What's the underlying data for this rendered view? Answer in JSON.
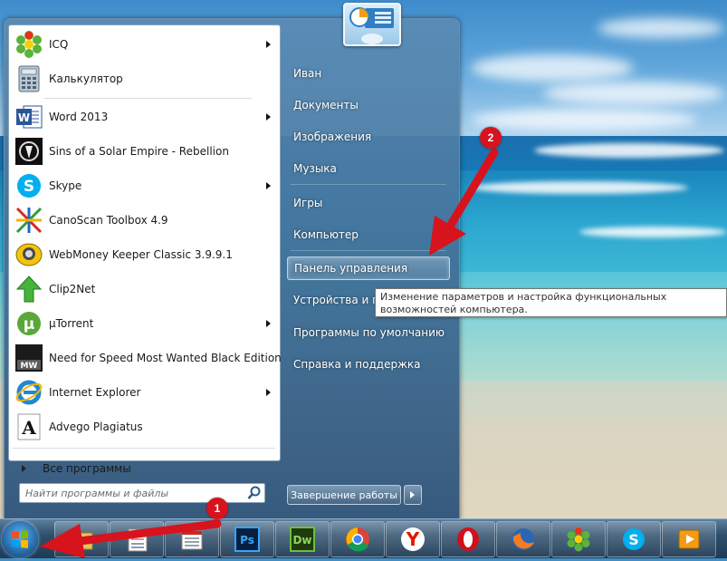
{
  "start_menu": {
    "programs": [
      {
        "label": "ICQ",
        "icon": "icq-flower-icon",
        "submenu": true
      },
      {
        "label": "Калькулятор",
        "icon": "calculator-icon",
        "submenu": false
      },
      {
        "label": "Word 2013",
        "icon": "word-icon",
        "submenu": true
      },
      {
        "label": "Sins of a Solar Empire - Rebellion",
        "icon": "sins-game-icon",
        "submenu": false
      },
      {
        "label": "Skype",
        "icon": "skype-icon",
        "submenu": true
      },
      {
        "label": "CanoScan Toolbox 4.9",
        "icon": "canoscan-icon",
        "submenu": false
      },
      {
        "label": "WebMoney Keeper Classic 3.9.9.1",
        "icon": "webmoney-icon",
        "submenu": false
      },
      {
        "label": "Clip2Net",
        "icon": "clip2net-arrow-icon",
        "submenu": false
      },
      {
        "label": "µTorrent",
        "icon": "utorrent-icon",
        "submenu": true
      },
      {
        "label": "Need for Speed Most Wanted Black Edition",
        "icon": "nfs-icon",
        "submenu": false
      },
      {
        "label": "Internet Explorer",
        "icon": "internet-explorer-icon",
        "submenu": true
      },
      {
        "label": "Advego Plagiatus",
        "icon": "advego-icon",
        "submenu": false
      }
    ],
    "all_programs_label": "Все программы",
    "search_placeholder": "Найти программы и файлы",
    "right_items": [
      {
        "label": "Иван"
      },
      {
        "label": "Документы"
      },
      {
        "label": "Изображения"
      },
      {
        "label": "Музыка"
      },
      {
        "label": "Игры"
      },
      {
        "label": "Компьютер"
      },
      {
        "label": "Панель управления"
      },
      {
        "label": "Устройства и пр"
      },
      {
        "label": "Программы по умолчанию"
      },
      {
        "label": "Справка и поддержка"
      }
    ],
    "shutdown_label": "Завершение работы",
    "tooltip": "Изменение параметров и настройка функциональных возможностей компьютера."
  },
  "annotations": {
    "badge_1": "1",
    "badge_2": "2",
    "arrow_color": "#d7131d"
  },
  "taskbar": {
    "items": [
      {
        "name": "explorer-icon"
      },
      {
        "name": "document-icon"
      },
      {
        "name": "photoshop-icon",
        "text": "Ps"
      },
      {
        "name": "dreamweaver-icon",
        "text": "Dw"
      },
      {
        "name": "chrome-icon"
      },
      {
        "name": "yandex-browser-icon"
      },
      {
        "name": "opera-icon"
      },
      {
        "name": "firefox-icon"
      },
      {
        "name": "icq-icon"
      },
      {
        "name": "skype-icon"
      },
      {
        "name": "media-player-icon"
      }
    ]
  }
}
